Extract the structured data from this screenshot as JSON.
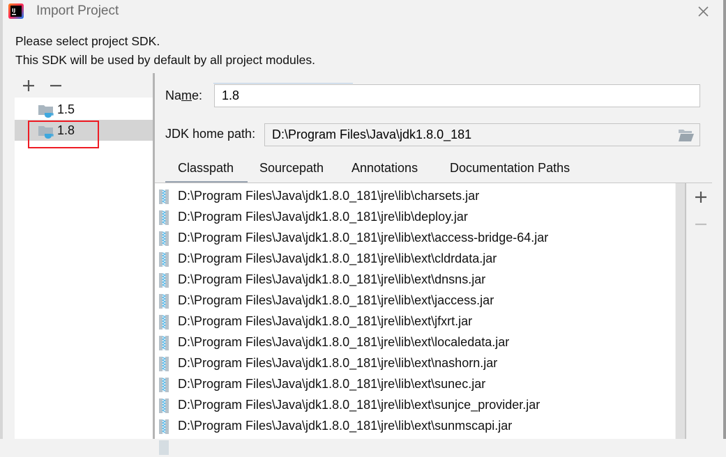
{
  "window": {
    "title": "Import Project",
    "app_icon": "intellij-idea-icon",
    "close_icon": "close-icon"
  },
  "description": {
    "line1": "Please select project SDK.",
    "line2": "This SDK will be used by default by all project modules."
  },
  "sdk_toolbar": {
    "add_icon": "plus-icon",
    "remove_icon": "minus-icon"
  },
  "sdk_list": {
    "items": [
      {
        "label": "1.5",
        "icon": "jdk-folder-icon",
        "selected": false
      },
      {
        "label": "1.8",
        "icon": "jdk-folder-icon",
        "selected": true
      }
    ],
    "highlight_color": "#ee1c24"
  },
  "form": {
    "name_label": "Name:",
    "name_mnemonic": "m",
    "name_value": "1.8",
    "jdk_home_label": "JDK home path:",
    "jdk_home_value": "D:\\Program Files\\Java\\jdk1.8.0_181",
    "browse_icon": "folder-open-icon"
  },
  "tabs": [
    {
      "label": "Classpath",
      "active": true
    },
    {
      "label": "Sourcepath",
      "active": false
    },
    {
      "label": "Annotations",
      "active": false
    },
    {
      "label": "Documentation Paths",
      "active": false
    }
  ],
  "classpath": [
    "D:\\Program Files\\Java\\jdk1.8.0_181\\jre\\lib\\charsets.jar",
    "D:\\Program Files\\Java\\jdk1.8.0_181\\jre\\lib\\deploy.jar",
    "D:\\Program Files\\Java\\jdk1.8.0_181\\jre\\lib\\ext\\access-bridge-64.jar",
    "D:\\Program Files\\Java\\jdk1.8.0_181\\jre\\lib\\ext\\cldrdata.jar",
    "D:\\Program Files\\Java\\jdk1.8.0_181\\jre\\lib\\ext\\dnsns.jar",
    "D:\\Program Files\\Java\\jdk1.8.0_181\\jre\\lib\\ext\\jaccess.jar",
    "D:\\Program Files\\Java\\jdk1.8.0_181\\jre\\lib\\ext\\jfxrt.jar",
    "D:\\Program Files\\Java\\jdk1.8.0_181\\jre\\lib\\ext\\localedata.jar",
    "D:\\Program Files\\Java\\jdk1.8.0_181\\jre\\lib\\ext\\nashorn.jar",
    "D:\\Program Files\\Java\\jdk1.8.0_181\\jre\\lib\\ext\\sunec.jar",
    "D:\\Program Files\\Java\\jdk1.8.0_181\\jre\\lib\\ext\\sunjce_provider.jar",
    "D:\\Program Files\\Java\\jdk1.8.0_181\\jre\\lib\\ext\\sunmscapi.jar"
  ],
  "classpath_toolbar": {
    "add_icon": "plus-icon",
    "remove_icon": "minus-icon",
    "remove_enabled": false
  }
}
